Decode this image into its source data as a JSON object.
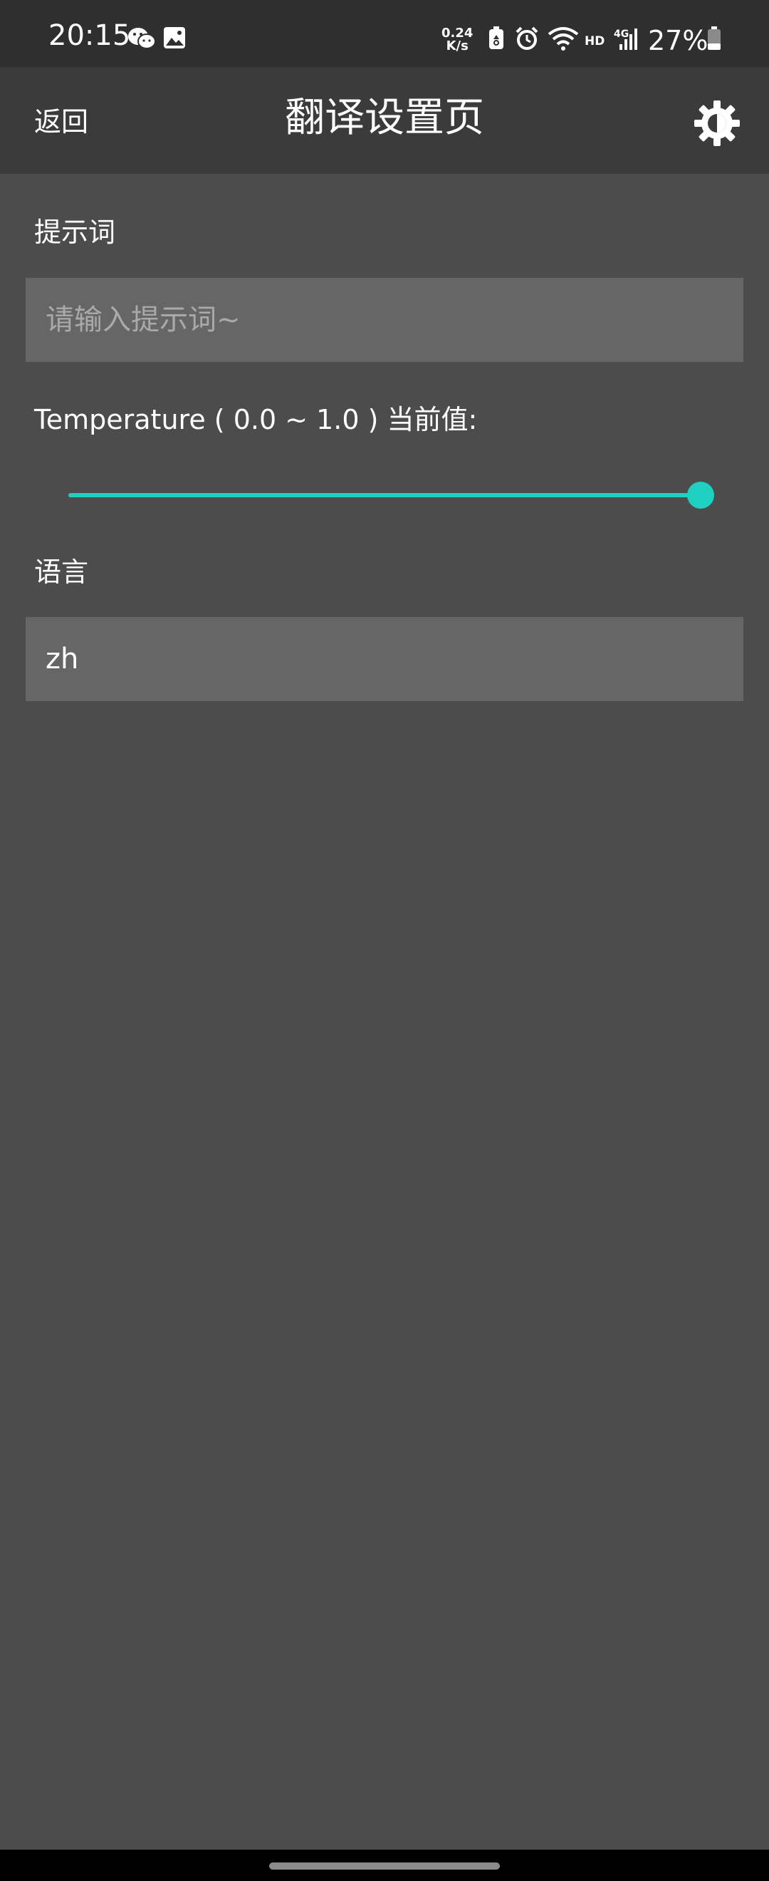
{
  "status_bar": {
    "time": "20:15",
    "net_speed_value": "0.24",
    "net_speed_unit": "K/s",
    "hd": "HD",
    "network": "4G",
    "battery": "27%",
    "icons": [
      "wechat-icon",
      "gallery-icon",
      "battery-saver-icon",
      "alarm-icon",
      "wifi-icon",
      "signal-icon",
      "battery-icon"
    ]
  },
  "appbar": {
    "back_label": "返回",
    "title": "翻译设置页",
    "settings_icon": "gear-icon"
  },
  "prompt": {
    "label": "提示词",
    "placeholder": "请输入提示词~",
    "value": ""
  },
  "temperature": {
    "label": "Temperature ( 0.0 ~ 1.0 ) 当前值:",
    "min": 0.0,
    "max": 1.0,
    "value": 1.0
  },
  "language": {
    "label": "语言",
    "value": "zh"
  },
  "colors": {
    "accent": "#1fcfbf",
    "background": "#4c4c4c",
    "appbar": "#3b3b3b",
    "statusbar": "#2f2f2f",
    "field": "#666666"
  }
}
